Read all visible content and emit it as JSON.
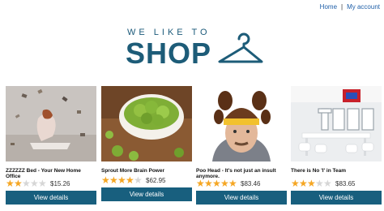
{
  "nav": {
    "home": "Home",
    "separator": "|",
    "account": "My account"
  },
  "logo": {
    "tagline": "WE LIKE TO",
    "word": "SHOP"
  },
  "colors": {
    "accent": "#185f7e",
    "link": "#1f5fa8",
    "star": "#f5a623"
  },
  "products": [
    {
      "title": "ZZZZZZ Bed - Your New Home Office",
      "rating": 2,
      "max_rating": 5,
      "price": "$15.26",
      "button": "View details",
      "image": "woman-floating-books"
    },
    {
      "title": "Sprout More Brain Power",
      "rating": 4,
      "max_rating": 5,
      "price": "$62.95",
      "button": "View details",
      "image": "brussels-sprouts-bowl"
    },
    {
      "title": "Poo Head - It's not just an insult anymore.",
      "rating": 5,
      "max_rating": 5,
      "price": "$83.46",
      "button": "View details",
      "image": "man-funny-hat"
    },
    {
      "title": "There is No 'I' in Team",
      "rating": 3,
      "max_rating": 5,
      "price": "$83.65",
      "button": "View details",
      "image": "team-meeting-room"
    }
  ]
}
